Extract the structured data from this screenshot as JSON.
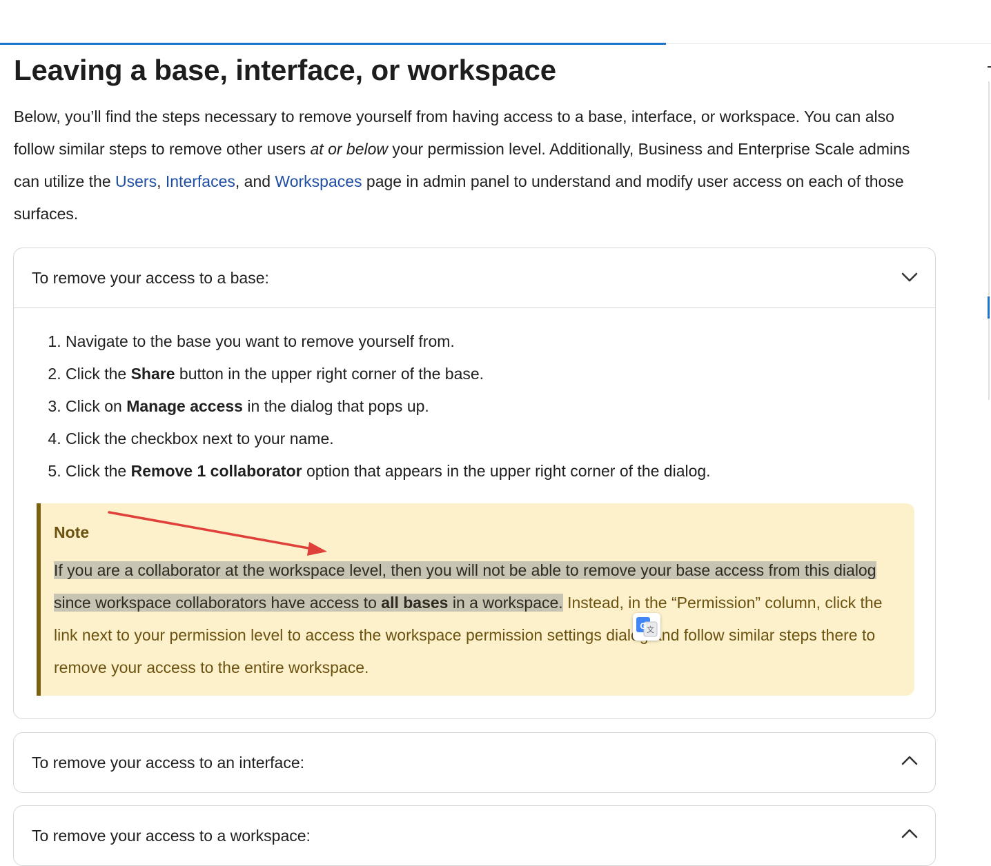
{
  "article": {
    "title": "Leaving a base, interface, or workspace",
    "intro": {
      "part1": "Below, you’ll find the steps necessary to remove yourself from having access to a base, interface, or workspace. You can also follow similar steps to remove other users ",
      "emphasis": "at or below",
      "part2": " your permission level. Additionally, Business and Enterprise Scale admins can utilize the ",
      "link_users": "Users",
      "sep1": ", ",
      "link_interfaces": "Interfaces",
      "sep2": ", and ",
      "link_workspaces": "Workspaces",
      "part3": " page in admin panel to understand and modify user access on each of those surfaces."
    }
  },
  "accordions": [
    {
      "title": "To remove your access to a base:",
      "expanded": true,
      "steps": [
        {
          "pre": "Navigate to the base you want to remove yourself from.",
          "bold": "",
          "post": ""
        },
        {
          "pre": "Click the ",
          "bold": "Share",
          "post": " button in the upper right corner of the base."
        },
        {
          "pre": "Click on ",
          "bold": "Manage access",
          "post": " in the dialog that pops up."
        },
        {
          "pre": "Click the checkbox next to your name.",
          "bold": "",
          "post": ""
        },
        {
          "pre": "Click the ",
          "bold": "Remove 1 collaborator",
          "post": " option that appears in the upper right corner of the dialog."
        }
      ],
      "note": {
        "title": "Note",
        "highlighted_pre": "If you are a collaborator at the workspace level, then you will not be able to remove your base access from this dialog since workspace collaborators have access to ",
        "highlighted_bold": "all bases",
        "highlighted_post": " in a workspace.",
        "rest": " Instead, in the “Permission” column, click the link next to your permission level to access the workspace permission settings dialog and follow similar steps there to remove your access to the entire workspace."
      }
    },
    {
      "title": "To remove your access to an interface:",
      "expanded": false
    },
    {
      "title": "To remove your access to a workspace:",
      "expanded": false
    }
  ],
  "reading_progress": 0.672,
  "colors": {
    "accent": "#1a73c8",
    "link": "#1f4fa3",
    "note_bg": "#fdf1cb",
    "note_text": "#6b5210",
    "highlight": "#c8c4b4",
    "annotation_arrow": "#e0403a"
  },
  "icons": {
    "chevron_down": "chevron-down-icon",
    "chevron_up": "chevron-up-icon",
    "translate": "google-translate-icon"
  }
}
